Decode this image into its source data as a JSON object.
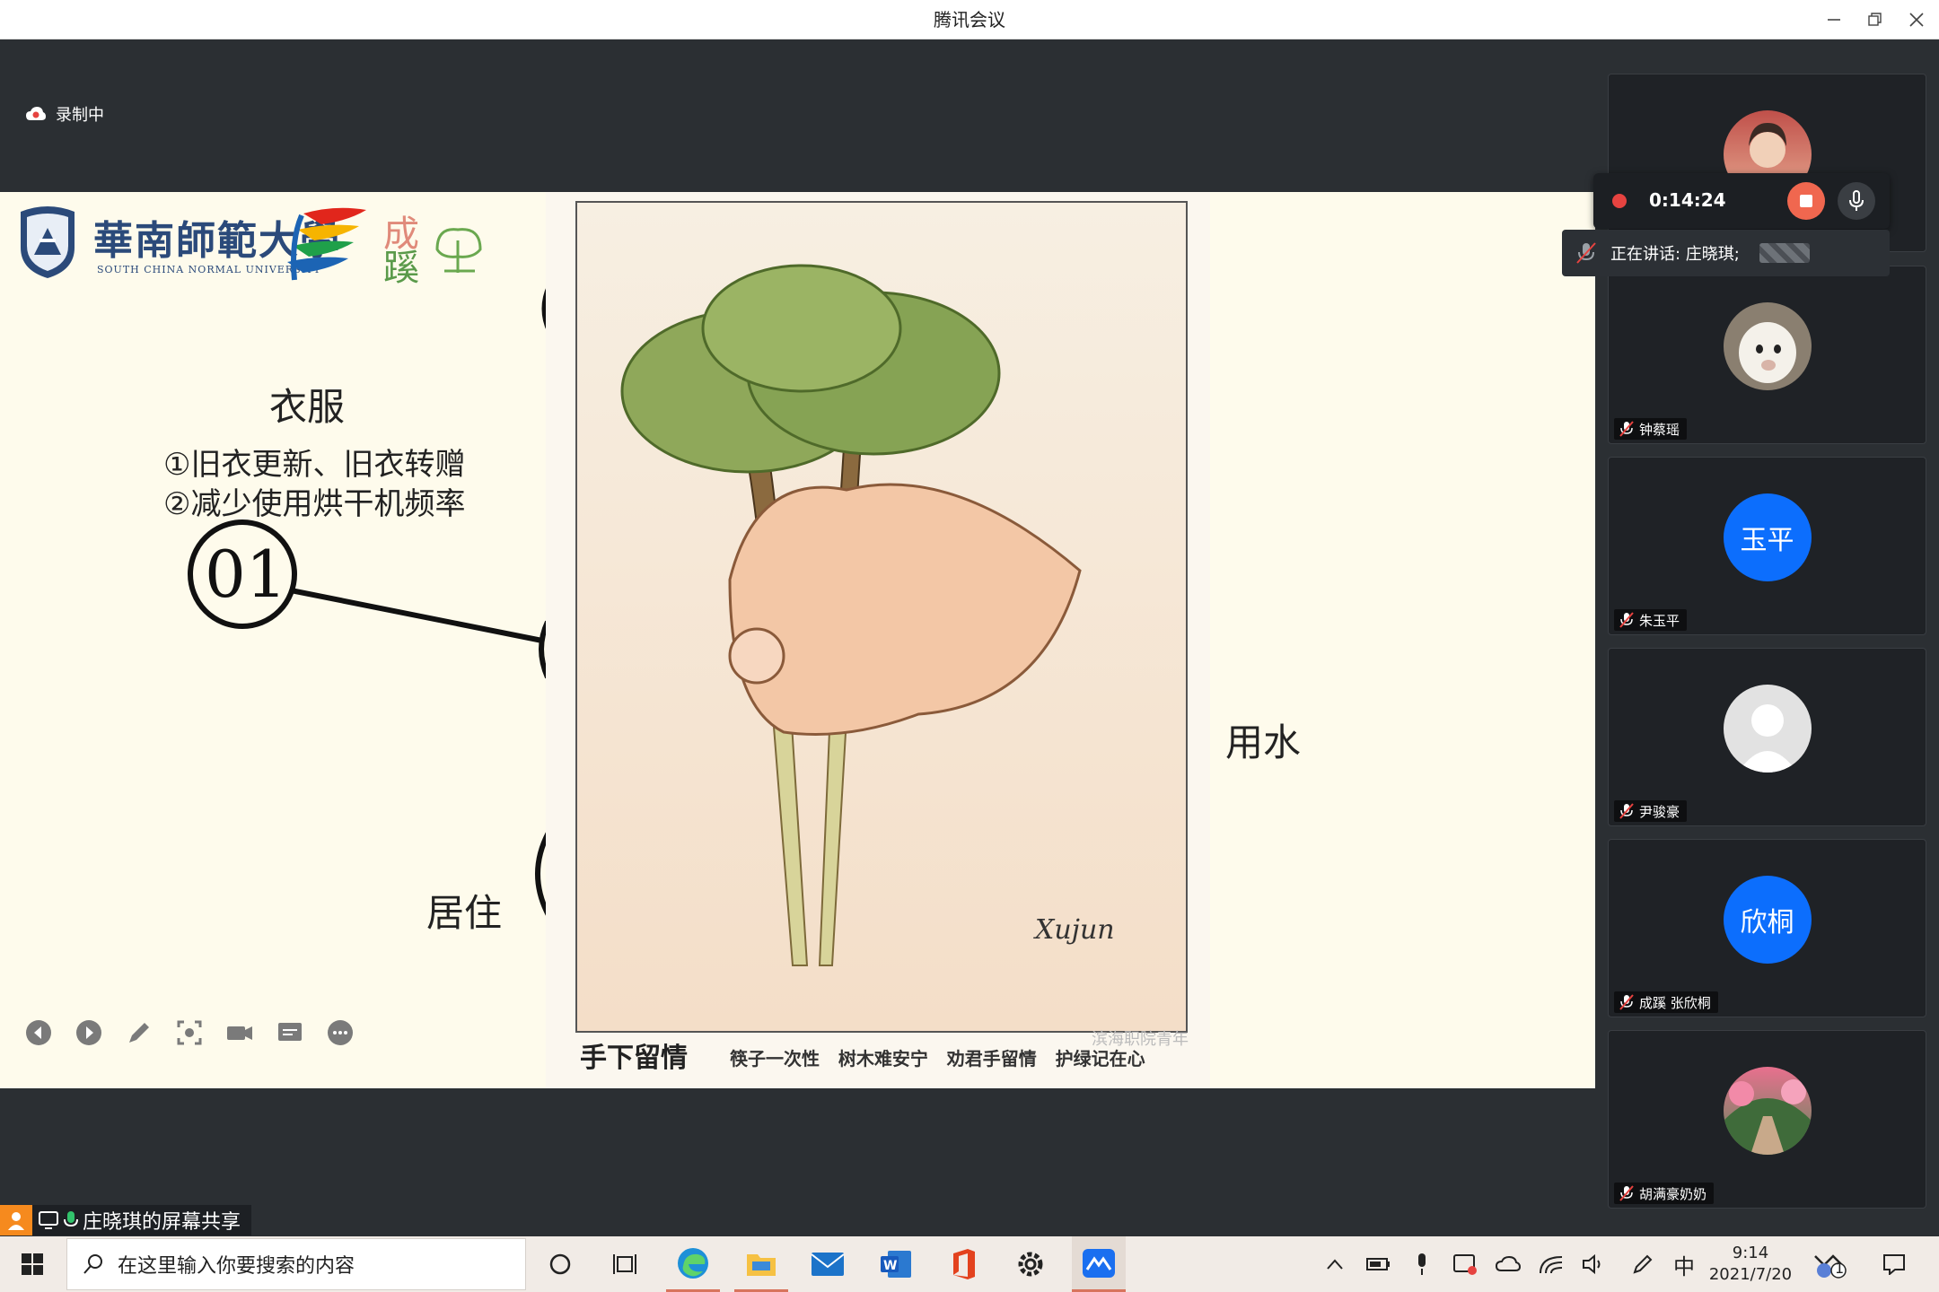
{
  "window": {
    "title": "腾讯会议"
  },
  "recording": {
    "status": "录制中"
  },
  "slide": {
    "clothing_title": "衣服",
    "clothing_item1": "①旧衣更新、旧衣转赠",
    "clothing_item2": "②减少使用烘干机频率",
    "number": "01",
    "housing": "居住",
    "water": "用水",
    "university_cn": "華南師範大學",
    "university_en": "SOUTH CHINA NORMAL UNIVERSITY",
    "logo_cheng": "成",
    "logo_xi": "蹊",
    "caption_title": "手下留情",
    "caption_text": "筷子一次性   树木难安宁   劝君手留情   护绿记在心",
    "watermark": "滨海职院青年",
    "signature": "Xujun"
  },
  "record_control": {
    "timer": "0:14:24"
  },
  "speaking": {
    "label": "正在讲话: 庄晓琪;"
  },
  "participants": [
    {
      "name": "",
      "initials": "",
      "muted": false
    },
    {
      "name": "钟蔡瑶",
      "initials": "",
      "muted": true
    },
    {
      "name": "朱玉平",
      "initials": "玉平",
      "muted": true
    },
    {
      "name": "尹骏豪",
      "initials": "",
      "muted": true
    },
    {
      "name": "成蹊 张欣桐",
      "initials": "欣桐",
      "muted": true
    },
    {
      "name": "胡满豪奶奶",
      "initials": "",
      "muted": true
    }
  ],
  "share_bar": {
    "label": "庄晓琪的屏幕共享"
  },
  "taskbar": {
    "search_placeholder": "在这里输入你要搜索的内容",
    "ime": "中",
    "time": "9:14",
    "date": "2021/7/20",
    "notif_count": "1"
  },
  "colors": {
    "accent_blue": "#0c6efd",
    "record_red": "#e64340",
    "stop_orange": "#f0674f"
  }
}
